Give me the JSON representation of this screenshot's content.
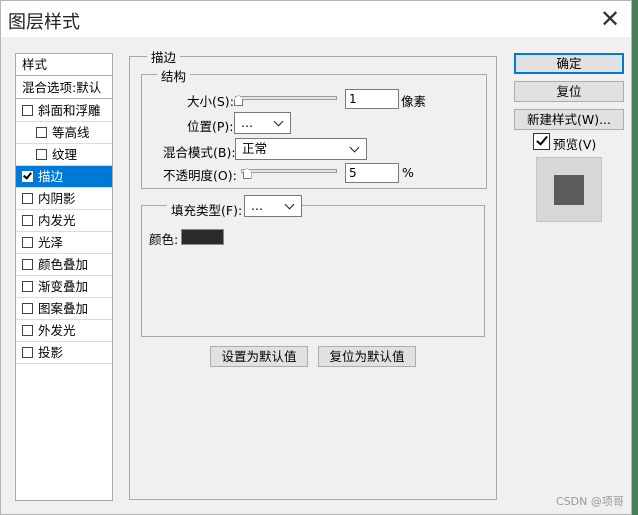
{
  "window": {
    "title": "图层样式",
    "close_glyph": "✕"
  },
  "style_list": {
    "header": "样式",
    "blend_options": "混合选项:默认",
    "items": [
      {
        "label": "斜面和浮雕",
        "checked": false,
        "indent": false
      },
      {
        "label": "等高线",
        "checked": false,
        "indent": true
      },
      {
        "label": "纹理",
        "checked": false,
        "indent": true
      },
      {
        "label": "描边",
        "checked": true,
        "indent": false,
        "selected": true
      },
      {
        "label": "内阴影",
        "checked": false,
        "indent": false
      },
      {
        "label": "内发光",
        "checked": false,
        "indent": false
      },
      {
        "label": "光泽",
        "checked": false,
        "indent": false
      },
      {
        "label": "颜色叠加",
        "checked": false,
        "indent": false
      },
      {
        "label": "渐变叠加",
        "checked": false,
        "indent": false
      },
      {
        "label": "图案叠加",
        "checked": false,
        "indent": false
      },
      {
        "label": "外发光",
        "checked": false,
        "indent": false
      },
      {
        "label": "投影",
        "checked": false,
        "indent": false
      }
    ]
  },
  "stroke": {
    "section_title": "描边",
    "structure_title": "结构",
    "size_label": "大小(S):",
    "size_value": "1",
    "size_unit": "像素",
    "size_fraction": 0.0,
    "position_label": "位置(P):",
    "position_value": "...",
    "blend_mode_label": "混合模式(B):",
    "blend_mode_value": "正常",
    "opacity_label": "不透明度(O):",
    "opacity_value": "5",
    "opacity_unit": "%",
    "opacity_fraction": 0.05,
    "fill_type_label": "填充类型(F):",
    "fill_type_value": "...",
    "color_label": "颜色:",
    "color_value": "#2b2b2b",
    "set_default_label": "设置为默认值",
    "reset_default_label": "复位为默认值"
  },
  "buttons": {
    "ok": "确定",
    "reset": "复位",
    "new_style": "新建样式(W)...",
    "preview_label": "预览(V)",
    "preview_checked": true
  },
  "watermark": "CSDN @项哥"
}
